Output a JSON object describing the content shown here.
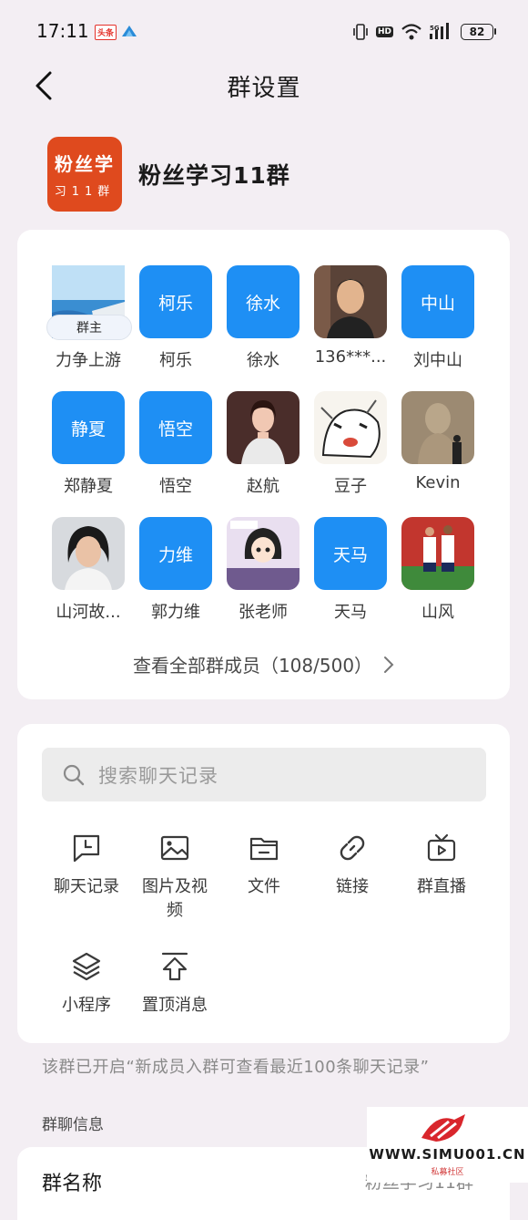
{
  "status_bar": {
    "time": "17:11",
    "badge": "头条",
    "battery": "82",
    "hd": "HD",
    "signal": "5G"
  },
  "nav": {
    "title": "群设置"
  },
  "group": {
    "name": "粉丝学习11群",
    "avatar_line1": "粉丝学",
    "avatar_line2": "习11群"
  },
  "members": [
    {
      "name": "力争上游",
      "avatar_type": "photo-sea",
      "tag": "群主"
    },
    {
      "name": "柯乐",
      "avatar_type": "blue",
      "avatar_text": "柯乐"
    },
    {
      "name": "徐水",
      "avatar_type": "blue",
      "avatar_text": "徐水"
    },
    {
      "name": "136***...",
      "avatar_type": "photo-man"
    },
    {
      "name": "刘中山",
      "avatar_type": "blue",
      "avatar_text": "中山"
    },
    {
      "name": "郑静夏",
      "avatar_type": "blue",
      "avatar_text": "静夏"
    },
    {
      "name": "悟空",
      "avatar_type": "blue",
      "avatar_text": "悟空"
    },
    {
      "name": "赵航",
      "avatar_type": "photo-woman"
    },
    {
      "name": "豆子",
      "avatar_type": "photo-sketch"
    },
    {
      "name": "Kevin",
      "avatar_type": "photo-statue"
    },
    {
      "name": "山河故...",
      "avatar_type": "photo-woman2"
    },
    {
      "name": "郭力维",
      "avatar_type": "blue",
      "avatar_text": "力维"
    },
    {
      "name": "张老师",
      "avatar_type": "photo-cartoon"
    },
    {
      "name": "天马",
      "avatar_type": "blue",
      "avatar_text": "天马"
    },
    {
      "name": "山风",
      "avatar_type": "photo-football"
    }
  ],
  "view_all_label": "查看全部群成员（108/500）",
  "search": {
    "placeholder": "搜索聊天记录"
  },
  "tools": [
    {
      "label": "聊天记录",
      "icon": "chat-history-icon"
    },
    {
      "label": "图片及视频",
      "icon": "image-icon"
    },
    {
      "label": "文件",
      "icon": "folder-icon"
    },
    {
      "label": "链接",
      "icon": "link-icon"
    },
    {
      "label": "群直播",
      "icon": "live-tv-icon"
    },
    {
      "label": "小程序",
      "icon": "layers-icon"
    },
    {
      "label": "置顶消息",
      "icon": "pin-top-icon"
    }
  ],
  "notice": "该群已开启“新成员入群可查看最近100条聊天记录”",
  "section_label": "群聊信息",
  "group_name_row": {
    "label": "群名称",
    "value": "粉丝学习11群"
  },
  "watermark": {
    "url": "WWW.SIMU001.CN",
    "sub": "私募社区"
  },
  "colors": {
    "accent_blue": "#1e8ff4",
    "group_avatar": "#df4a1e",
    "background": "#f3eef3"
  }
}
